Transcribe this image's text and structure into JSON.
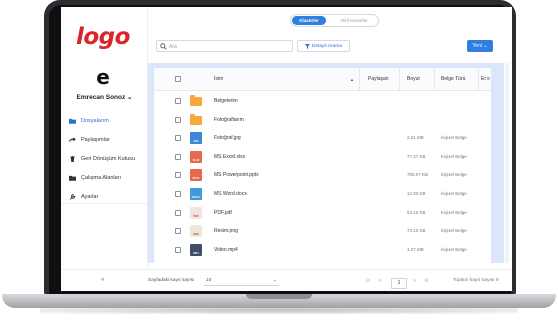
{
  "app": {
    "logo_text": "logo",
    "brand_color": "#d8262a",
    "accent_color": "#2f7fe0"
  },
  "user": {
    "avatar_letter": "e",
    "name": "Emrecan Sonoz ⌄"
  },
  "toggle": {
    "active_label": "Klasörler",
    "inactive_label": "Aktif Klasörler"
  },
  "toolbar": {
    "search_placeholder": "Ara",
    "filter_label": "Detaylı Arama",
    "new_label": "Yeni ⌄"
  },
  "sidebar": {
    "items": [
      {
        "label": "Dosyalarım",
        "icon": "folder-icon",
        "active": true
      },
      {
        "label": "Paylaşımlar",
        "icon": "share-icon",
        "active": false
      },
      {
        "label": "Geri Dönüşüm Kutusu",
        "icon": "trash-icon",
        "active": false
      },
      {
        "label": "Çalışma Alanları",
        "icon": "workspace-icon",
        "active": false
      },
      {
        "label": "Ayarlar",
        "icon": "settings-icon",
        "active": false
      }
    ]
  },
  "table": {
    "headers": {
      "name": "İsim",
      "sort_indicator": "▲",
      "shared": "Paylaşan",
      "size": "Boyut",
      "doc_type": "Belge Türü",
      "extra": "Er"
    },
    "rows": [
      {
        "name": "Belgelerim",
        "type": "folder",
        "thumb_label": "",
        "thumb_color": "#f7a93b",
        "size": "",
        "doc_type": ""
      },
      {
        "name": "Fotoğraflarım",
        "type": "folder",
        "thumb_label": "",
        "thumb_color": "#f7a93b",
        "size": "",
        "doc_type": ""
      },
      {
        "name": "Fotoğraf.jpg",
        "type": "image",
        "thumb_label": "JPG",
        "thumb_color": "#3d87d6",
        "size": "2.21 MB",
        "doc_type": "Kişisel Belge"
      },
      {
        "name": "MS Excel.xlsx",
        "type": "excel",
        "thumb_label": "XLSX",
        "thumb_color": "#e46a4b",
        "size": "77.27 KB",
        "doc_type": "Kişisel Belge"
      },
      {
        "name": "MS Powerpoint.pptx",
        "type": "powerpoint",
        "thumb_label": "PPTX",
        "thumb_color": "#e46a4b",
        "size": "705.07 KB",
        "doc_type": "Kişisel Belge"
      },
      {
        "name": "MS Word.docx",
        "type": "word",
        "thumb_label": "DOCX",
        "thumb_color": "#3d9bdc",
        "size": "12.93 KB",
        "doc_type": "Kişisel Belge"
      },
      {
        "name": "PDF.pdf",
        "type": "pdf",
        "thumb_label": "PDF",
        "thumb_color": "#f1e4e2",
        "size": "53.10 KB",
        "doc_type": "Kişisel Belge"
      },
      {
        "name": "Resim.png",
        "type": "png",
        "thumb_label": "PNG",
        "thumb_color": "#efe6da",
        "size": "73.10 KB",
        "doc_type": "Kişisel Belge"
      },
      {
        "name": "Video.mp4",
        "type": "video",
        "thumb_label": "MP4",
        "thumb_color": "#3f4f6a",
        "size": "1.27 MB",
        "doc_type": "Kişisel Belge"
      }
    ]
  },
  "footer": {
    "collapse_label": "«",
    "page_size_label": "Sayfadaki kayıt sayısı",
    "page_size_value": "10",
    "page_size_caret": "⌄",
    "first": "|<",
    "prev": "<",
    "page": "1",
    "next": ">",
    "last": ">|",
    "total": "Toplam kayıt Sayısı 9"
  }
}
